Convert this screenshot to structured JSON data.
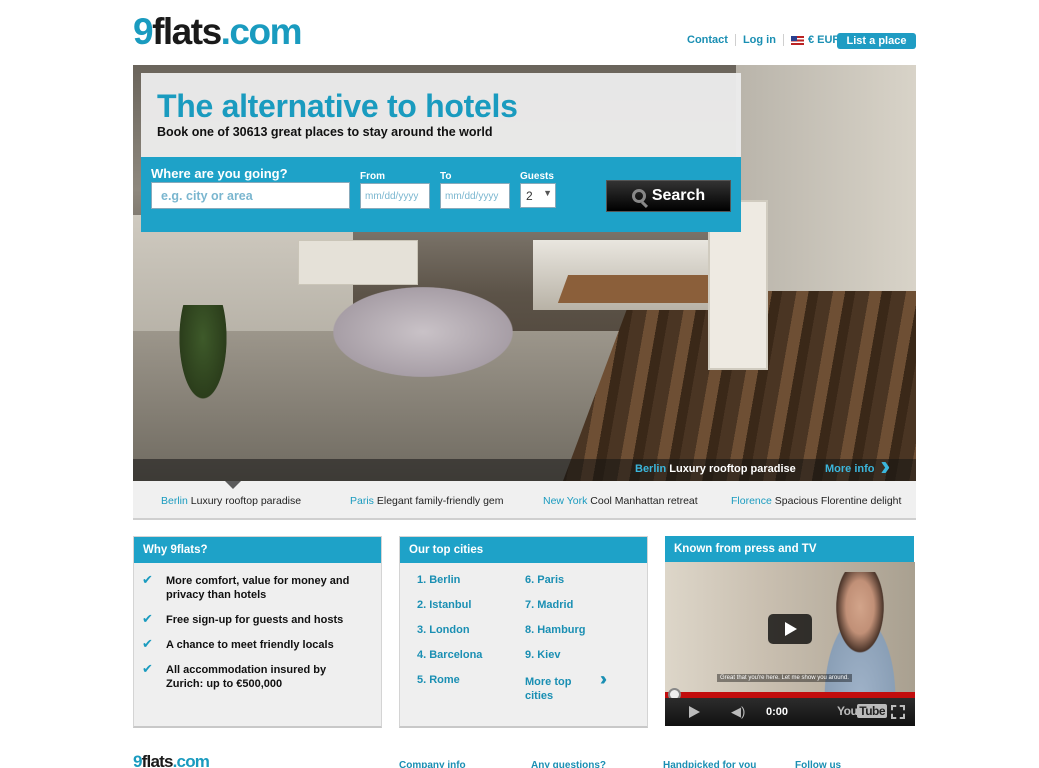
{
  "logo": {
    "part1": "9",
    "part2": "flats",
    "part3": ".com"
  },
  "topnav": {
    "contact": "Contact",
    "login": "Log in",
    "currency": "€ EUR",
    "list_place": "List a place"
  },
  "hero": {
    "headline": "The alternative to hotels",
    "subline": "Book one of 30613 great places to stay around the world",
    "search": {
      "where_label": "Where are you going?",
      "where_placeholder": "e.g. city or area",
      "from_label": "From",
      "from_placeholder": "mm/dd/yyyy",
      "to_label": "To",
      "to_placeholder": "mm/dd/yyyy",
      "guests_label": "Guests",
      "guests_value": "2",
      "search_button": "Search"
    },
    "caption": {
      "city": "Berlin",
      "title": "Luxury rooftop paradise",
      "more_info": "More info"
    }
  },
  "featured": [
    {
      "city": "Berlin",
      "title": "Luxury rooftop paradise"
    },
    {
      "city": "Paris",
      "title": "Elegant family-friendly gem"
    },
    {
      "city": "New York",
      "title": "Cool Manhattan retreat"
    },
    {
      "city": "Florence",
      "title": "Spacious Florentine delight"
    }
  ],
  "why": {
    "title": "Why 9flats?",
    "items": [
      "More comfort, value for money and privacy than hotels",
      "Free sign-up for guests and hosts",
      "A chance to meet friendly locals",
      "All accommodation insured by Zurich: up to €500,000"
    ]
  },
  "top_cities": {
    "title": "Our top cities",
    "left": [
      "1. Berlin",
      "2. Istanbul",
      "3. London",
      "4. Barcelona",
      "5. Rome"
    ],
    "right": [
      "6. Paris",
      "7. Madrid",
      "8. Hamburg",
      "9. Kiev"
    ],
    "more": "More top cities"
  },
  "press": {
    "title": "Known from press and TV",
    "subtitle": "Great that you're here. Let me show you around.",
    "time": "0:00",
    "youtube_you": "You",
    "youtube_tube": "Tube"
  },
  "footer": {
    "logo": {
      "part1": "9",
      "part2": "flats",
      "part3": ".com"
    },
    "headings": [
      "Company info",
      "Any questions?",
      "Handpicked for you",
      "Follow us"
    ]
  },
  "colors": {
    "brand": "#1ea2c8",
    "link": "#1a8fb3",
    "dark": "#111111"
  }
}
